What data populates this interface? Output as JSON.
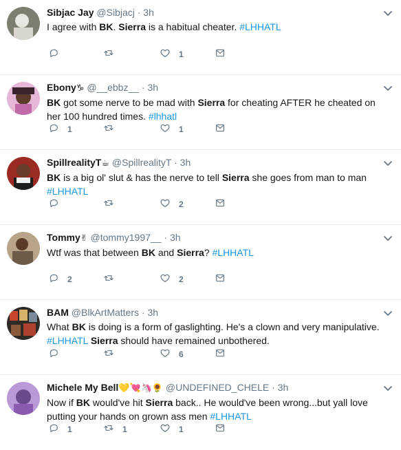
{
  "tweets": [
    {
      "name": "Sibjac Jay",
      "name_emoji": "",
      "handle": "@Sibjacj",
      "time": "3h",
      "segments": [
        {
          "t": "I agree with ",
          "s": "plain"
        },
        {
          "t": "BK",
          "s": "bold"
        },
        {
          "t": ". ",
          "s": "plain"
        },
        {
          "t": "Sierra",
          "s": "bold"
        },
        {
          "t": " is a habitual cheater. ",
          "s": "plain"
        },
        {
          "t": "#LHHATL",
          "s": "tag"
        }
      ],
      "replies": "",
      "retweets": "",
      "likes": "1"
    },
    {
      "name": "Ebony",
      "name_emoji": "♑",
      "handle": "@__ebbz__",
      "time": "3h",
      "segments": [
        {
          "t": "BK",
          "s": "bold"
        },
        {
          "t": " got some nerve to be mad with ",
          "s": "plain"
        },
        {
          "t": "Sierra",
          "s": "bold"
        },
        {
          "t": " for cheating AFTER he cheated on her 100 hundred times. ",
          "s": "plain"
        },
        {
          "t": "#lhhatl",
          "s": "tag"
        }
      ],
      "replies": "1",
      "retweets": "",
      "likes": "1"
    },
    {
      "name": "SpillrealityT",
      "name_emoji": "☕",
      "handle": "@SpillrealityT",
      "time": "3h",
      "segments": [
        {
          "t": "BK",
          "s": "bold"
        },
        {
          "t": " is a big ol' slut & has the nerve to tell ",
          "s": "plain"
        },
        {
          "t": "Sierra",
          "s": "bold"
        },
        {
          "t": " she goes from man to man ",
          "s": "plain"
        },
        {
          "t": "#LHHATL",
          "s": "tag"
        }
      ],
      "replies": "",
      "retweets": "",
      "likes": "2"
    },
    {
      "name": "Tommy",
      "name_emoji": "✌",
      "handle": "@tommy1997__",
      "time": "3h",
      "segments": [
        {
          "t": "Wtf was that between ",
          "s": "plain"
        },
        {
          "t": "BK",
          "s": "bold"
        },
        {
          "t": " and ",
          "s": "plain"
        },
        {
          "t": "Sierra",
          "s": "bold"
        },
        {
          "t": "?  ",
          "s": "plain"
        },
        {
          "t": "#LHHATL",
          "s": "tag"
        }
      ],
      "replies": "2",
      "retweets": "",
      "likes": "2"
    },
    {
      "name": "BAM",
      "name_emoji": "",
      "handle": "@BlkArtMatters",
      "time": "3h",
      "segments": [
        {
          "t": "What ",
          "s": "plain"
        },
        {
          "t": "BK",
          "s": "bold"
        },
        {
          "t": " is doing is a form of gaslighting. He's a clown and very manipulative. ",
          "s": "plain"
        },
        {
          "t": "#LHHATL",
          "s": "tag"
        },
        {
          "t": " ",
          "s": "plain"
        },
        {
          "t": "Sierra",
          "s": "bold"
        },
        {
          "t": " should have remained unbothered.",
          "s": "plain"
        }
      ],
      "replies": "",
      "retweets": "",
      "likes": "6"
    },
    {
      "name": "Michele My Bell",
      "name_emoji": "💛💘🦄🌻",
      "handle": "@UNDEFINED_CHELE",
      "time": "3h",
      "segments": [
        {
          "t": "Now if ",
          "s": "plain"
        },
        {
          "t": "BK",
          "s": "bold"
        },
        {
          "t": " would've hit ",
          "s": "plain"
        },
        {
          "t": "Sierra",
          "s": "bold"
        },
        {
          "t": " back.. He would've been wrong...but yall love putting your hands on grown ass men ",
          "s": "plain"
        },
        {
          "t": "#LHHATL",
          "s": "tag"
        }
      ],
      "replies": "1",
      "retweets": "1",
      "likes": "1"
    }
  ],
  "icons": {
    "reply": "reply-icon",
    "retweet": "retweet-icon",
    "like": "heart-icon",
    "dm": "envelope-icon",
    "menu": "chevron-down-icon"
  },
  "colors": {
    "text": "#14171a",
    "muted": "#657786",
    "hashtag": "#1b95e0",
    "divider": "#e6ecf0"
  }
}
